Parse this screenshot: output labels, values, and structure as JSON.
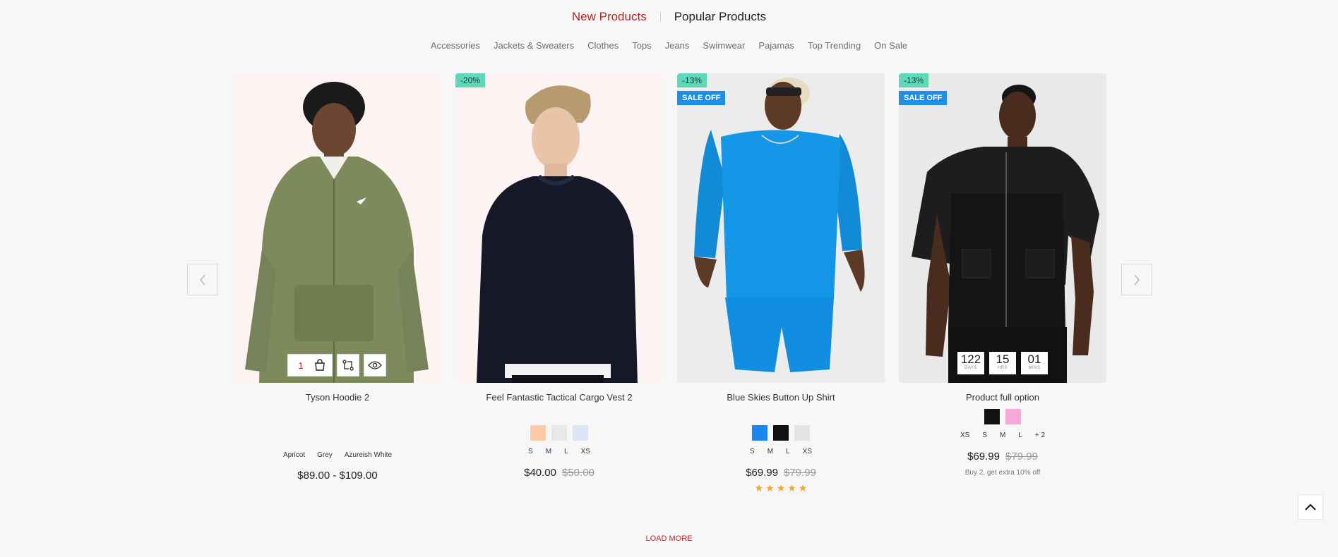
{
  "tabs": [
    {
      "label": "New Products",
      "active": true
    },
    {
      "label": "Popular Products",
      "active": false
    }
  ],
  "categories": [
    "Accessories",
    "Jackets & Sweaters",
    "Clothes",
    "Tops",
    "Jeans",
    "Swimwear",
    "Pajamas",
    "Top Trending",
    "On Sale"
  ],
  "nav": {
    "prev_icon": "chevron-left-icon",
    "next_icon": "chevron-right-icon"
  },
  "products": [
    {
      "title": "Tyson Hoodie 2",
      "quantity": "1",
      "variant_labels": [
        "Apricot",
        "Grey",
        "Azureish White"
      ],
      "price": "$89.00 - $109.00"
    },
    {
      "title": "Feel Fantastic Tactical Cargo Vest 2",
      "badge": "-20%",
      "colors": [
        "#ffc8a8",
        "#e8e8e8",
        "#dde6f7"
      ],
      "sizes": [
        "S",
        "M",
        "L",
        "XS"
      ],
      "price": "$40.00",
      "old_price": "$50.00"
    },
    {
      "title": "Blue Skies Button Up Shirt",
      "badge": "-13%",
      "sale_label": "SALE OFF",
      "colors": [
        "#1a86f0",
        "#111111",
        "#e4e4e4"
      ],
      "sizes": [
        "S",
        "M",
        "L",
        "XS"
      ],
      "price": "$69.99",
      "old_price": "$79.99",
      "rating": 5
    },
    {
      "title": "Product full option",
      "badge": "-13%",
      "sale_label": "SALE OFF",
      "countdown": [
        {
          "value": "122",
          "label": "DAYS"
        },
        {
          "value": "15",
          "label": "HRS"
        },
        {
          "value": "01",
          "label": "MINS"
        }
      ],
      "colors": [
        "#111111",
        "#f7a8d8"
      ],
      "sizes": [
        "XS",
        "S",
        "M",
        "L",
        "+ 2"
      ],
      "price": "$69.99",
      "old_price": "$79.99",
      "promo": "Buy 2, get extra 10% off"
    }
  ],
  "load_more": "LOAD MORE",
  "scroll_top_icon": "chevron-up-icon"
}
